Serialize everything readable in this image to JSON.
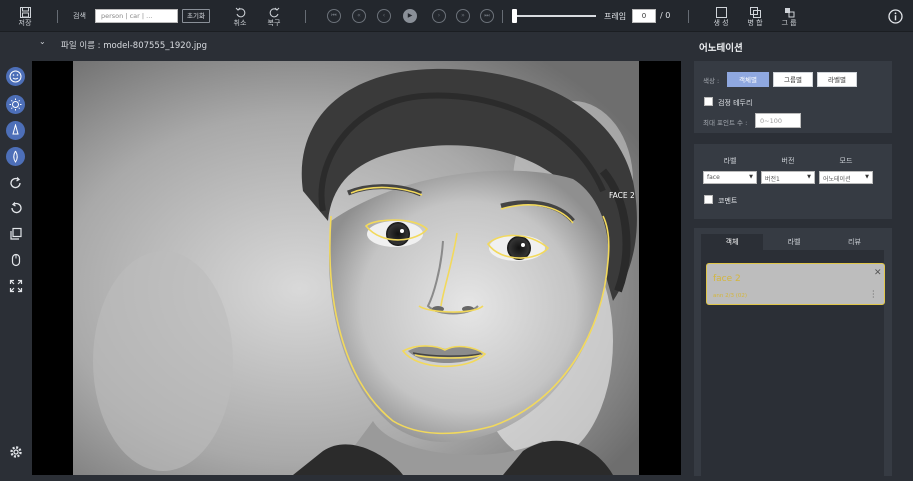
{
  "toolbar": {
    "save_label": "저장",
    "search_label": "검색",
    "search_placeholder": "person | car | ...",
    "reset_label": "초기화",
    "undo_label": "취소",
    "redo_label": "복구",
    "frame_label": "프레임",
    "frame_value": "0",
    "frame_total": "/ 0",
    "create_label": "생 성",
    "merge_label": "병 합",
    "group_label": "그 룹",
    "player_buttons": [
      "first",
      "prev-10",
      "prev",
      "play",
      "next",
      "next-10",
      "last"
    ]
  },
  "filename": {
    "text": "파일 이름 : model-807555_1920.jpg"
  },
  "canvas": {
    "label_text": "FACE 2",
    "annotation_color": "#f2d95c"
  },
  "annotation_panel": {
    "title": "어노테이션",
    "color_label": "색상 :",
    "color_options": [
      "객체별",
      "그룹별",
      "라벨별"
    ],
    "black_border_label": "검정 테두리",
    "max_points_label": "최대 포인트 수 :",
    "max_points_placeholder": "0~100"
  },
  "label_panel": {
    "label_head": "라벨",
    "version_head": "버전",
    "mode_head": "모드",
    "label_value": "face",
    "version_value": "버전1",
    "mode_value": "어노테이션",
    "code_label": "코멘트"
  },
  "object_tabs": [
    "객체",
    "라벨",
    "리뷰"
  ],
  "object_card": {
    "title": "face 2",
    "subtitle": "ann 2/3 (02)"
  },
  "colors": {
    "accent": "#8fa8e0",
    "sidebar_icon": "#4d6fb8",
    "annotation": "#f2d95c",
    "background": "#2b2f36"
  }
}
